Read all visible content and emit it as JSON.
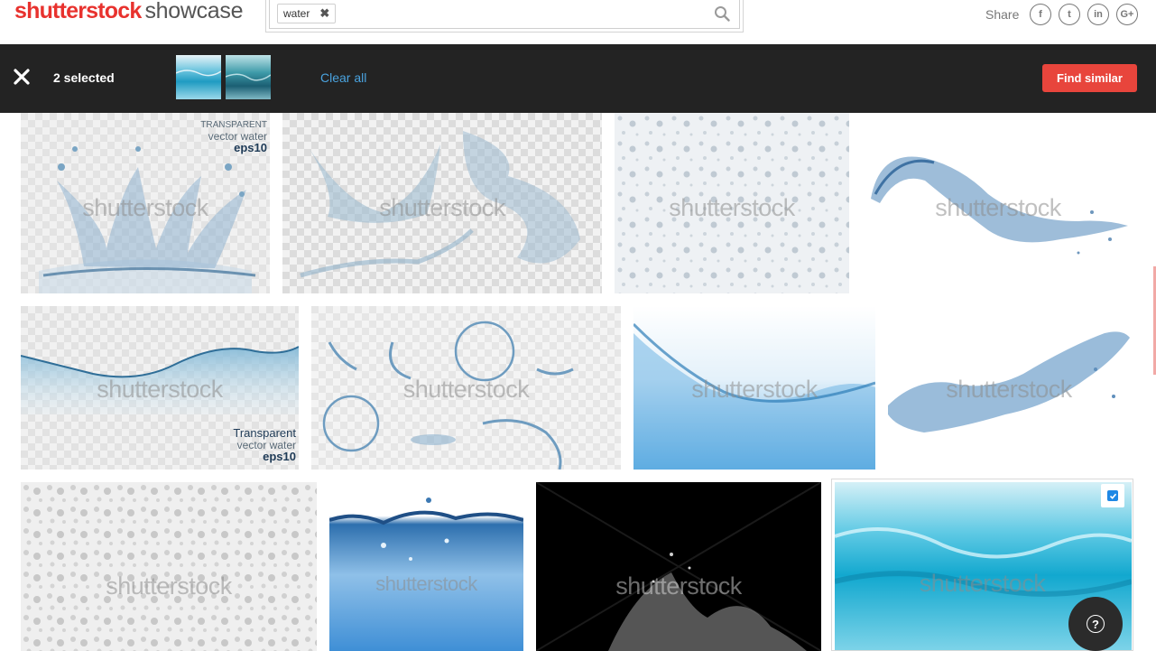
{
  "header": {
    "logo_brand": "shutterstock",
    "logo_sub": "showcase",
    "search_chip": "water",
    "share_label": "Share",
    "social": [
      {
        "name": "facebook-icon",
        "glyph": "f"
      },
      {
        "name": "twitter-icon",
        "glyph": "t"
      },
      {
        "name": "linkedin-icon",
        "glyph": "in"
      },
      {
        "name": "google-plus-icon",
        "glyph": "G+"
      }
    ]
  },
  "selection_bar": {
    "count_text": "2 selected",
    "clear_all": "Clear all",
    "find_similar": "Find similar"
  },
  "grid": {
    "watermark": "shutterstock",
    "captions": {
      "tile1": [
        "TRANSPARENT",
        "vector water",
        "eps10"
      ],
      "tile5": [
        "Transparent",
        "vector water",
        "eps10"
      ]
    }
  },
  "colors": {
    "brand_red": "#e8322e",
    "bar_bg": "#232323",
    "link_blue": "#4aa3df",
    "button_red": "#e8453c",
    "check_blue": "#1e88e5"
  },
  "icons": {
    "search": "search-icon",
    "close": "close-icon",
    "help": "help-icon",
    "checkbox": "checkbox-checked-icon"
  },
  "help_glyph": "?"
}
